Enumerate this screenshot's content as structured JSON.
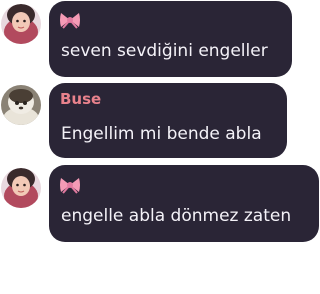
{
  "colors": {
    "bubble_background": "#2a2536",
    "message_text": "#f4f2f8",
    "bow_pink": "#f59bb6",
    "sender_name_buse": "#e8828c"
  },
  "messages": [
    {
      "sender_name": "",
      "sender_badge": "pink-bow-emoji",
      "text": "seven sevdiğini engeller",
      "avatar": "avatar-user-child-photo"
    },
    {
      "sender_name": "Buse",
      "sender_badge": "",
      "text": "Engellim mi bende abla",
      "avatar": "avatar-buse-photo"
    },
    {
      "sender_name": "",
      "sender_badge": "pink-bow-emoji",
      "text": "engelle abla dönmez zaten",
      "avatar": "avatar-user-child-photo"
    }
  ]
}
